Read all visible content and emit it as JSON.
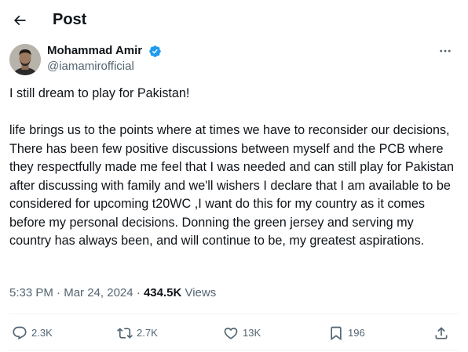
{
  "header": {
    "title": "Post",
    "back_icon": "arrow-left-icon"
  },
  "author": {
    "name": "Mohammad Amir",
    "handle": "@iamamirofficial",
    "verified": true,
    "verified_color": "#1d9bf0"
  },
  "post": {
    "line1": "I still dream to play for Pakistan!",
    "body": "life brings us to the points where at times we have to reconsider our decisions, There has been few positive discussions between myself and the PCB where they respectfully made me feel that I was needed and can still play for Pakistan after discussing with family and we'll wishers I declare that I am available to be considered for upcoming t20WC ,I want do this for my country as it comes before my personal decisions. Donning the green jersey and serving my country has always been, and will continue to be, my greatest aspirations."
  },
  "meta": {
    "time": "5:33 PM",
    "separator": " · ",
    "date": "Mar 24, 2024",
    "separator2": " · ",
    "views_count": "434.5K",
    "views_label": " Views"
  },
  "actions": {
    "replies": "2.3K",
    "reposts": "2.7K",
    "likes": "13K",
    "bookmarks": "196"
  },
  "colors": {
    "text": "#0f1419",
    "secondary": "#536471",
    "divider": "#eff3f4"
  }
}
